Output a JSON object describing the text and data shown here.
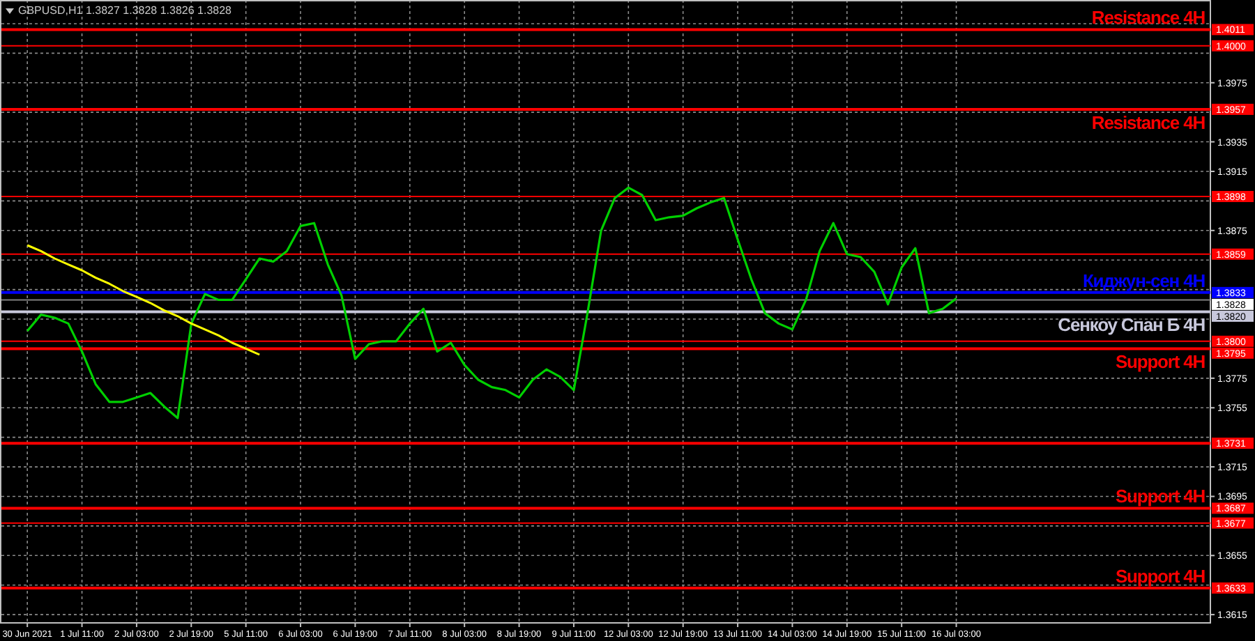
{
  "chart": {
    "title": "GBPUSD,H1  1.3827 1.3828 1.3826 1.3828",
    "chart_data": {
      "type": "line",
      "grid": true,
      "ylim": [
        1.36094,
        1.4031
      ],
      "categories": [
        "30 Jun 2021",
        null,
        null,
        null,
        "1 Jul 11:00",
        null,
        null,
        null,
        "2 Jul 03:00",
        null,
        null,
        null,
        "2 Jul 19:00",
        null,
        null,
        null,
        "5 Jul 11:00",
        null,
        null,
        null,
        "6 Jul 03:00",
        null,
        null,
        null,
        "6 Jul 19:00",
        null,
        null,
        null,
        "7 Jul 11:00",
        null,
        null,
        null,
        "8 Jul 03:00",
        null,
        null,
        null,
        "8 Jul 19:00",
        null,
        null,
        null,
        "9 Jul 11:00",
        null,
        null,
        null,
        "12 Jul 03:00",
        null,
        null,
        null,
        "12 Jul 19:00",
        null,
        null,
        null,
        "13 Jul 11:00",
        null,
        null,
        null,
        "14 Jul 03:00",
        null,
        null,
        null,
        "14 Jul 19:00",
        null,
        null,
        null,
        "15 Jul 11:00",
        null,
        null,
        null,
        "16 Jul 03:00"
      ],
      "series": [
        {
          "color": "#00d000",
          "values": [
            1.3807,
            1.3818,
            1.3816,
            1.3812,
            1.3793,
            1.3771,
            1.3759,
            1.3759,
            1.3762,
            1.3765,
            1.3756,
            1.3748,
            1.3812,
            1.3832,
            1.3828,
            1.3828,
            1.3842,
            1.3856,
            1.3854,
            1.3861,
            1.3878,
            1.388,
            1.3852,
            1.3831,
            1.3788,
            1.3798,
            1.38,
            1.38,
            1.3812,
            1.3822,
            1.3793,
            1.3799,
            1.3784,
            1.3774,
            1.3769,
            1.3767,
            1.3762,
            1.3774,
            1.3781,
            1.3776,
            1.3767,
            1.3819,
            1.3875,
            1.3897,
            1.3904,
            1.3899,
            1.3882,
            1.3884,
            1.3885,
            1.389,
            1.3894,
            1.3897,
            1.3869,
            1.3842,
            1.3819,
            1.3812,
            1.3808,
            1.3828,
            1.3861,
            1.388,
            1.3859,
            1.3857,
            1.3847,
            1.3825,
            1.385,
            1.3863,
            1.3819,
            1.3822,
            1.3829
          ]
        },
        {
          "color": "#ffff00",
          "values": [
            1.3865,
            1.3861,
            1.3856,
            1.3852,
            1.3848,
            1.3843,
            1.3839,
            1.3834,
            1.383,
            1.3826,
            1.3821,
            1.3817,
            1.3812,
            1.3808,
            1.3804,
            1.3799,
            1.3795,
            1.3791,
            null,
            null,
            null,
            null,
            null,
            null,
            null,
            null,
            null,
            null,
            null,
            null,
            null,
            null,
            null,
            null,
            null,
            null,
            null,
            null,
            null,
            null,
            null,
            null,
            null,
            null,
            null,
            null,
            null,
            null,
            null,
            null,
            null,
            null,
            null,
            null,
            null,
            null,
            null,
            null,
            null,
            null,
            null,
            null,
            null,
            null,
            null,
            null,
            null,
            null,
            null
          ]
        }
      ],
      "yticks": [
        {
          "value": 1.3975,
          "label": "1.3975"
        },
        {
          "value": 1.3935,
          "label": "1.3935"
        },
        {
          "value": 1.3915,
          "label": "1.3915"
        },
        {
          "value": 1.3875,
          "label": "1.3875"
        },
        {
          "value": 1.3775,
          "label": "1.3775"
        },
        {
          "value": 1.3755,
          "label": "1.3755"
        },
        {
          "value": 1.3715,
          "label": "1.3715"
        },
        {
          "value": 1.3695,
          "label": "1.3695"
        },
        {
          "value": 1.3655,
          "label": "1.3655"
        },
        {
          "value": 1.3615,
          "label": "1.3615"
        }
      ],
      "ref_lines": [
        {
          "axis": "y",
          "value": 1.4011,
          "label": "1.4011",
          "color": "#ff0000"
        },
        {
          "axis": "y",
          "value": 1.4,
          "label": "1.4000",
          "color": "#ff0000"
        },
        {
          "axis": "y",
          "value": 1.3957,
          "label": "1.3957",
          "color": "#ff0000"
        },
        {
          "axis": "y",
          "value": 1.3898,
          "label": "1.3898",
          "color": "#ff0000"
        },
        {
          "axis": "y",
          "value": 1.3859,
          "label": "1.3859",
          "color": "#ff0000"
        },
        {
          "axis": "y",
          "value": 1.3833,
          "label": "1.3833",
          "color": "#0000ff"
        },
        {
          "axis": "y",
          "value": 1.3828,
          "label": "1.3828",
          "color": "#808080"
        },
        {
          "axis": "y",
          "value": 1.382,
          "label": "1.3820",
          "color": "#c8c8dc"
        },
        {
          "axis": "y",
          "value": 1.38,
          "label": "1.3800",
          "color": "#ff0000"
        },
        {
          "axis": "y",
          "value": 1.3795,
          "label": "1.3795",
          "color": "#ff0000"
        },
        {
          "axis": "y",
          "value": 1.3731,
          "label": "1.3731",
          "color": "#ff0000"
        },
        {
          "axis": "y",
          "value": 1.3687,
          "label": "1.3687",
          "color": "#ff0000"
        },
        {
          "axis": "y",
          "value": 1.3677,
          "label": "1.3677",
          "color": "#ff0000"
        },
        {
          "axis": "y",
          "value": 1.3633,
          "label": "1.3633",
          "color": "#ff0000"
        }
      ]
    },
    "levels": [
      {
        "kind": "thick",
        "caption": "Resistance 4H",
        "caption_below": false
      },
      {
        "kind": "thin"
      },
      {
        "kind": "thick",
        "caption": "Resistance 4H",
        "caption_below": true
      },
      {
        "kind": "thin"
      },
      {
        "kind": "thin"
      },
      {
        "kind": "thick",
        "caption": "Киджун-сен 4H",
        "caption_below": false
      },
      {
        "kind": "current"
      },
      {
        "kind": "thick",
        "caption": "Сенкоу Спан Б 4H",
        "caption_below": true
      },
      {
        "kind": "thin"
      },
      {
        "kind": "thick",
        "caption": "Support 4H",
        "caption_below": true
      },
      {
        "kind": "thick"
      },
      {
        "kind": "thick",
        "caption": "Support 4H",
        "caption_below": false
      },
      {
        "kind": "thin"
      },
      {
        "kind": "thick",
        "caption": "Support 4H",
        "caption_below": false
      }
    ]
  }
}
